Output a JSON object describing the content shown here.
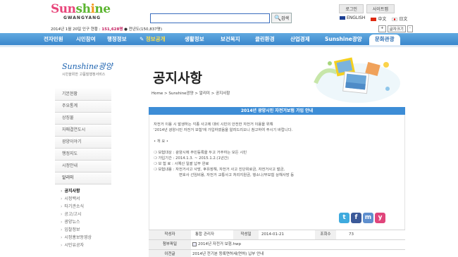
{
  "header": {
    "logo": {
      "part1": "Sun",
      "part2": "sh",
      "part3": "i",
      "part4": "ne",
      "sub": "GWANGYANG"
    },
    "search": {
      "value": "",
      "button": "검색"
    },
    "top_buttons": [
      "로그인",
      "사이트맵"
    ],
    "languages": [
      {
        "label": "ENGLISH",
        "flag_color": "#1c3f94"
      },
      {
        "label": "中文",
        "flag_color": "#de2910"
      },
      {
        "label": "日文",
        "flag_color": "#ffffff"
      }
    ],
    "population_prefix": "2014년 1월 20일 인구 현황 : ",
    "population_value": "151,628명",
    "population_suffix": " ● 전년도(150,837명)",
    "font_controls": [
      "+",
      "글자크기",
      "-"
    ]
  },
  "nav": {
    "items": [
      "전자민원",
      "시민참여",
      "행정정보",
      "정보공개",
      "생활정보",
      "보건복지",
      "클린환경",
      "산업경제",
      "Sunshine광양",
      "문화관광"
    ],
    "active_index": 3,
    "bg_color": "#3a87cc",
    "active_color": "#ffe04a"
  },
  "sidebar": {
    "logo_main": "Sunshine광양",
    "logo_sub": "시민을위한 고품질행정서비스",
    "items": [
      "기본현황",
      "주요통계",
      "상징물",
      "자매결연도시",
      "광양이야기",
      "행정지도",
      "시정안내",
      "알리미"
    ],
    "open_index": 7,
    "subitems": [
      "공지사항",
      "시정백서",
      "타기관소식",
      "공고/고시",
      "광양뉴스",
      "입찰정보",
      "시정홍보동영상",
      "시민유공자"
    ],
    "current_sub_index": 0
  },
  "page": {
    "title": "공지사항",
    "breadcrumb": "Home > Sunshine광양 > 알리미 > 공지사항"
  },
  "notice": {
    "heading": "2014년 광양시민 자전거보험 가입 안내",
    "lines": [
      "자전거 이용 시 발생하는 각종 사고에 대비 시민의 안전한 자전거 이용을 위해",
      "'2014년 광양시민 자전거 보험'에 가입하였음을 알려드리오니 참고하여 주시기 바랍니다.",
      "",
      "• 개 요 •",
      "",
      "보험대상 : 광양시에 주민등록을 두고 거주하는 모든 시민",
      "가입기간 : 2014.1.3. ~ 2015.1.2.(1년간)",
      "보 험 료 : 시예산 일괄 납부 완료",
      "보험내용 : 자전거사고 사망, 후유장해, 자전거 사고 진단위로금, 자전거사고 벌금,",
      "변호사 선임비용, 자전거 교통사고 처리지원금, 행소나/무보험 상해사망 등"
    ],
    "bullet_indexes": [
      5,
      6,
      7,
      8
    ],
    "indent_indexes": [
      9
    ],
    "author_label": "작성자",
    "author": "통합 관리자",
    "date_label": "작성일",
    "date": "2014-01-21",
    "views_label": "조회수",
    "views": "73",
    "attach_label": "첨부파일",
    "attach": "2014년 자전거 보험.hwp",
    "prev_label": "이전글",
    "prev": "2014년 전기분 등록면허세(면허) 납부 안내"
  },
  "sns": [
    {
      "name": "twitter-icon",
      "glyph": "t",
      "color": "#3eaade"
    },
    {
      "name": "facebook-icon",
      "glyph": "f",
      "color": "#3b5998"
    },
    {
      "name": "me2day-icon",
      "glyph": "m",
      "color": "#5f8fce"
    },
    {
      "name": "yozm-icon",
      "glyph": "y",
      "color": "#e0457b"
    }
  ]
}
